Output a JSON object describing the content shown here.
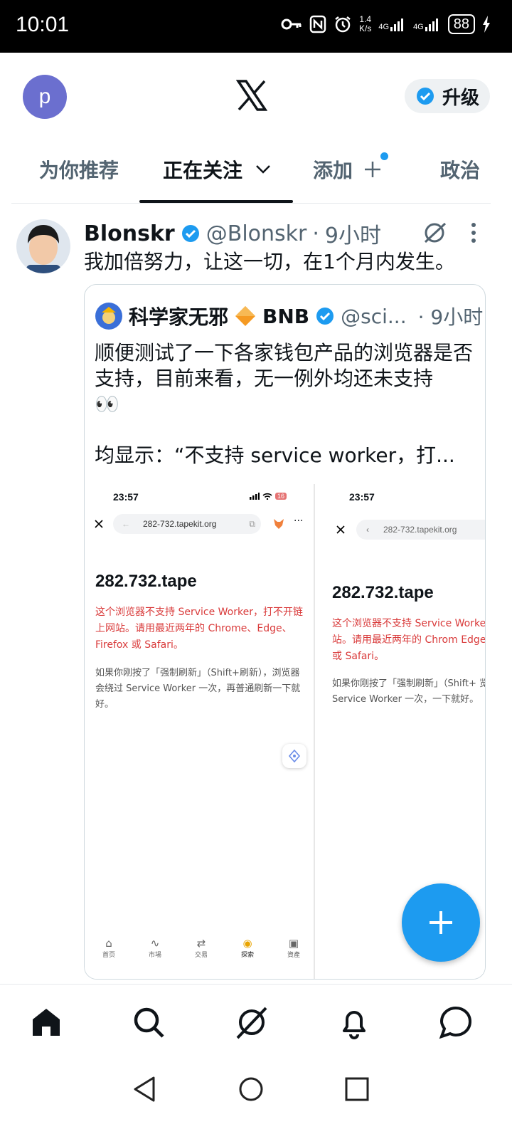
{
  "status_bar": {
    "time": "10:01",
    "net_speed_value": "1.4",
    "net_speed_unit": "K/s",
    "signal1_label": "4G",
    "signal2_label": "4G",
    "battery": "88"
  },
  "header": {
    "avatar_letter": "p",
    "upgrade_label": "升级"
  },
  "tabs": [
    {
      "label": "为你推荐"
    },
    {
      "label": "正在关注"
    },
    {
      "label": "添加"
    },
    {
      "label": "政治"
    }
  ],
  "tweet": {
    "author_name": "Blonskr",
    "author_handle": "@Blonskr",
    "separator": "·",
    "time": "9小时",
    "text": "我加倍努力，让这一切，在1个月内发生。",
    "quote": {
      "author_name": "科学家无邪",
      "badge_text": "BNB",
      "handle": "@sci...",
      "time": "· 9小时",
      "text_line1": "顺便测试了一下各家钱包产品的浏览器是否支持，目前来看，无一例外均还未支持",
      "emoji": "👀",
      "text_line2": "均显示：“不支持 service worker，打...",
      "screenshot1": {
        "time": "23:57",
        "battery": "16",
        "url": "282-732.tapekit.org",
        "title": "282.732.tape",
        "red_text": "这个浏览器不支持 Service Worker，打不开链上网站。请用最近两年的 Chrome、Edge、Firefox 或 Safari。",
        "grey_text": "如果你刚按了「强制刷新」（Shift+刷新），浏览器会绕过 Service Worker 一次，再普通刷新一下就好。",
        "nav": [
          "首页",
          "市場",
          "交易",
          "探索",
          "資產"
        ]
      },
      "screenshot2": {
        "time": "23:57",
        "url": "282-732.tapekit.org",
        "title": "282.732.tape",
        "red_text": "这个浏览器不支持 Service Worke 链上网站。请用最近两年的 Chrom Edge、Firefox 或 Safari。",
        "grey_text": "如果你刚按了「强制刷新」（Shift+ 览器会绕过 Service Worker 一次，一下就好。"
      }
    }
  },
  "colors": {
    "accent": "#1d9bf0",
    "text_primary": "#0f1419",
    "text_secondary": "#536471",
    "warning_red": "#d93a3a"
  }
}
